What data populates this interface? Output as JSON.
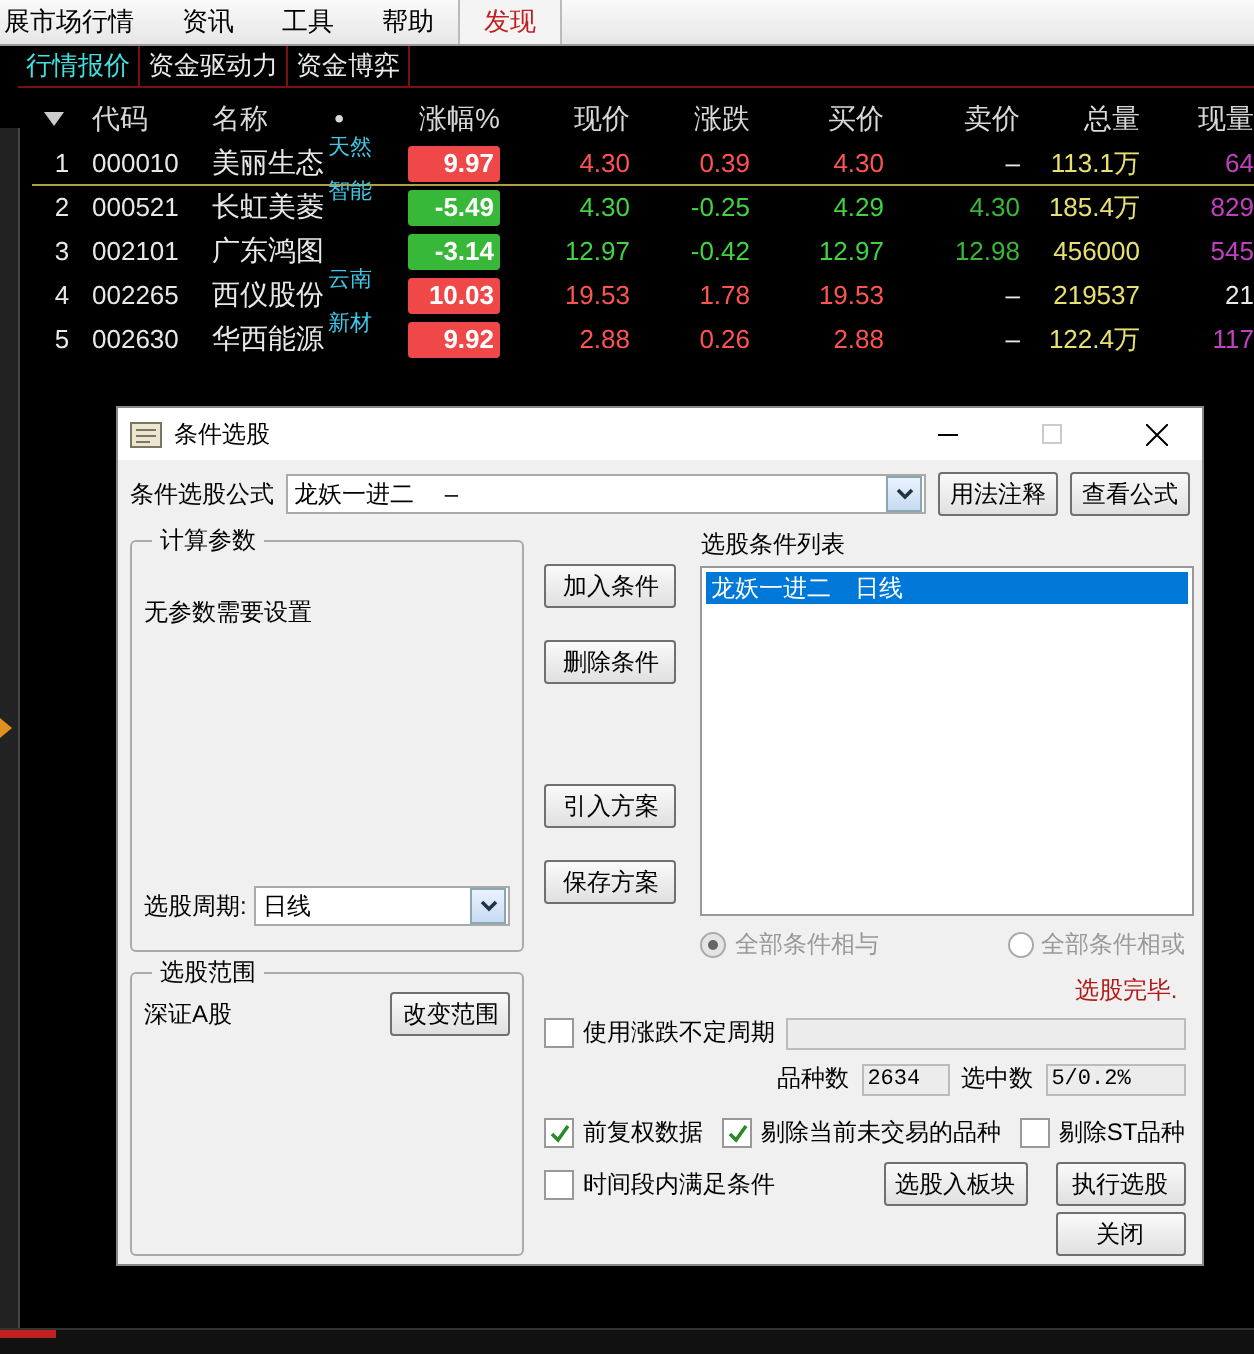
{
  "menu": [
    {
      "label": "展市场行情",
      "highlighted": false
    },
    {
      "label": "资讯",
      "highlighted": false
    },
    {
      "label": "工具",
      "highlighted": false
    },
    {
      "label": "帮助",
      "highlighted": false
    },
    {
      "label": "发现",
      "highlighted": true
    }
  ],
  "tabs": [
    {
      "label": "行情报价",
      "selected": true
    },
    {
      "label": "资金驱动力",
      "selected": false
    },
    {
      "label": "资金博弈",
      "selected": false
    }
  ],
  "table": {
    "columns": [
      "代码",
      "名称",
      "•",
      "涨幅%",
      "现价",
      "涨跌",
      "买价",
      "卖价",
      "总量",
      "现量"
    ],
    "rows": [
      {
        "index": "1",
        "code": "000010",
        "name": "美丽生态",
        "tag": "天然",
        "change": "9.97",
        "price": "4.30",
        "diff": "0.39",
        "bid": "4.30",
        "ask": "–",
        "volume": "113.1万",
        "current": {
          "text": "64",
          "color": "#c040c0"
        },
        "color": "#f04848",
        "selected": true
      },
      {
        "index": "2",
        "code": "000521",
        "name": "长虹美菱",
        "tag": "智能",
        "change": "-5.49",
        "price": "4.30",
        "diff": "-0.25",
        "bid": "4.29",
        "ask": "4.30",
        "volume": "185.4万",
        "current": {
          "text": "829",
          "color": "#c040c0"
        },
        "color": "#38b838",
        "selected": false
      },
      {
        "index": "3",
        "code": "002101",
        "name": "广东鸿图",
        "tag": "",
        "change": "-3.14",
        "price": "12.97",
        "diff": "-0.42",
        "bid": "12.97",
        "ask": "12.98",
        "volume": "456000",
        "current": {
          "text": "545",
          "color": "#c040c0"
        },
        "color": "#38b838",
        "selected": false
      },
      {
        "index": "4",
        "code": "002265",
        "name": "西仪股份",
        "tag": "云南",
        "change": "10.03",
        "price": "19.53",
        "diff": "1.78",
        "bid": "19.53",
        "ask": "–",
        "volume": "219537",
        "current": {
          "text": "21",
          "color": "#e8e8e8"
        },
        "color": "#f04848",
        "selected": false
      },
      {
        "index": "5",
        "code": "002630",
        "name": "华西能源",
        "tag": "新材",
        "change": "9.92",
        "price": "2.88",
        "diff": "0.26",
        "bid": "2.88",
        "ask": "–",
        "volume": "122.4万",
        "current": {
          "text": "117",
          "color": "#c040c0"
        },
        "color": "#f04848",
        "selected": false
      }
    ]
  },
  "dialog": {
    "title": "条件选股",
    "formula_label": "条件选股公式",
    "formula_value": "龙妖一进二　 –",
    "top_buttons": [
      "用法注释",
      "查看公式"
    ],
    "params_title": "计算参数",
    "params_text": "无参数需要设置",
    "period_label": "选股周期:",
    "period_value": "日线",
    "range_title": "选股范围",
    "range_value": "深证A股",
    "range_button": "改变范围",
    "middle_buttons": [
      "加入条件",
      "删除条件",
      "引入方案",
      "保存方案"
    ],
    "list_title": "选股条件列表",
    "list_items": [
      {
        "text": "龙妖一进二　日线",
        "selected": true
      }
    ],
    "radios": [
      {
        "label": "全部条件相与",
        "selected": true,
        "disabled": true
      },
      {
        "label": "全部条件相或",
        "selected": false,
        "disabled": true
      }
    ],
    "status": "选股完毕.",
    "uncertain_period": {
      "label": "使用涨跌不定周期",
      "checked": false
    },
    "count_label": "品种数",
    "count_value": "2634",
    "selected_label": "选中数",
    "selected_value": "5/0.2%",
    "options": [
      {
        "label": "前复权数据",
        "checked": true
      },
      {
        "label": "剔除当前未交易的品种",
        "checked": true
      },
      {
        "label": "剔除ST品种",
        "checked": false
      }
    ],
    "time_option": {
      "label": "时间段内满足条件",
      "checked": false
    },
    "bottom_buttons": [
      "选股入板块",
      "执行选股",
      "关闭"
    ]
  }
}
